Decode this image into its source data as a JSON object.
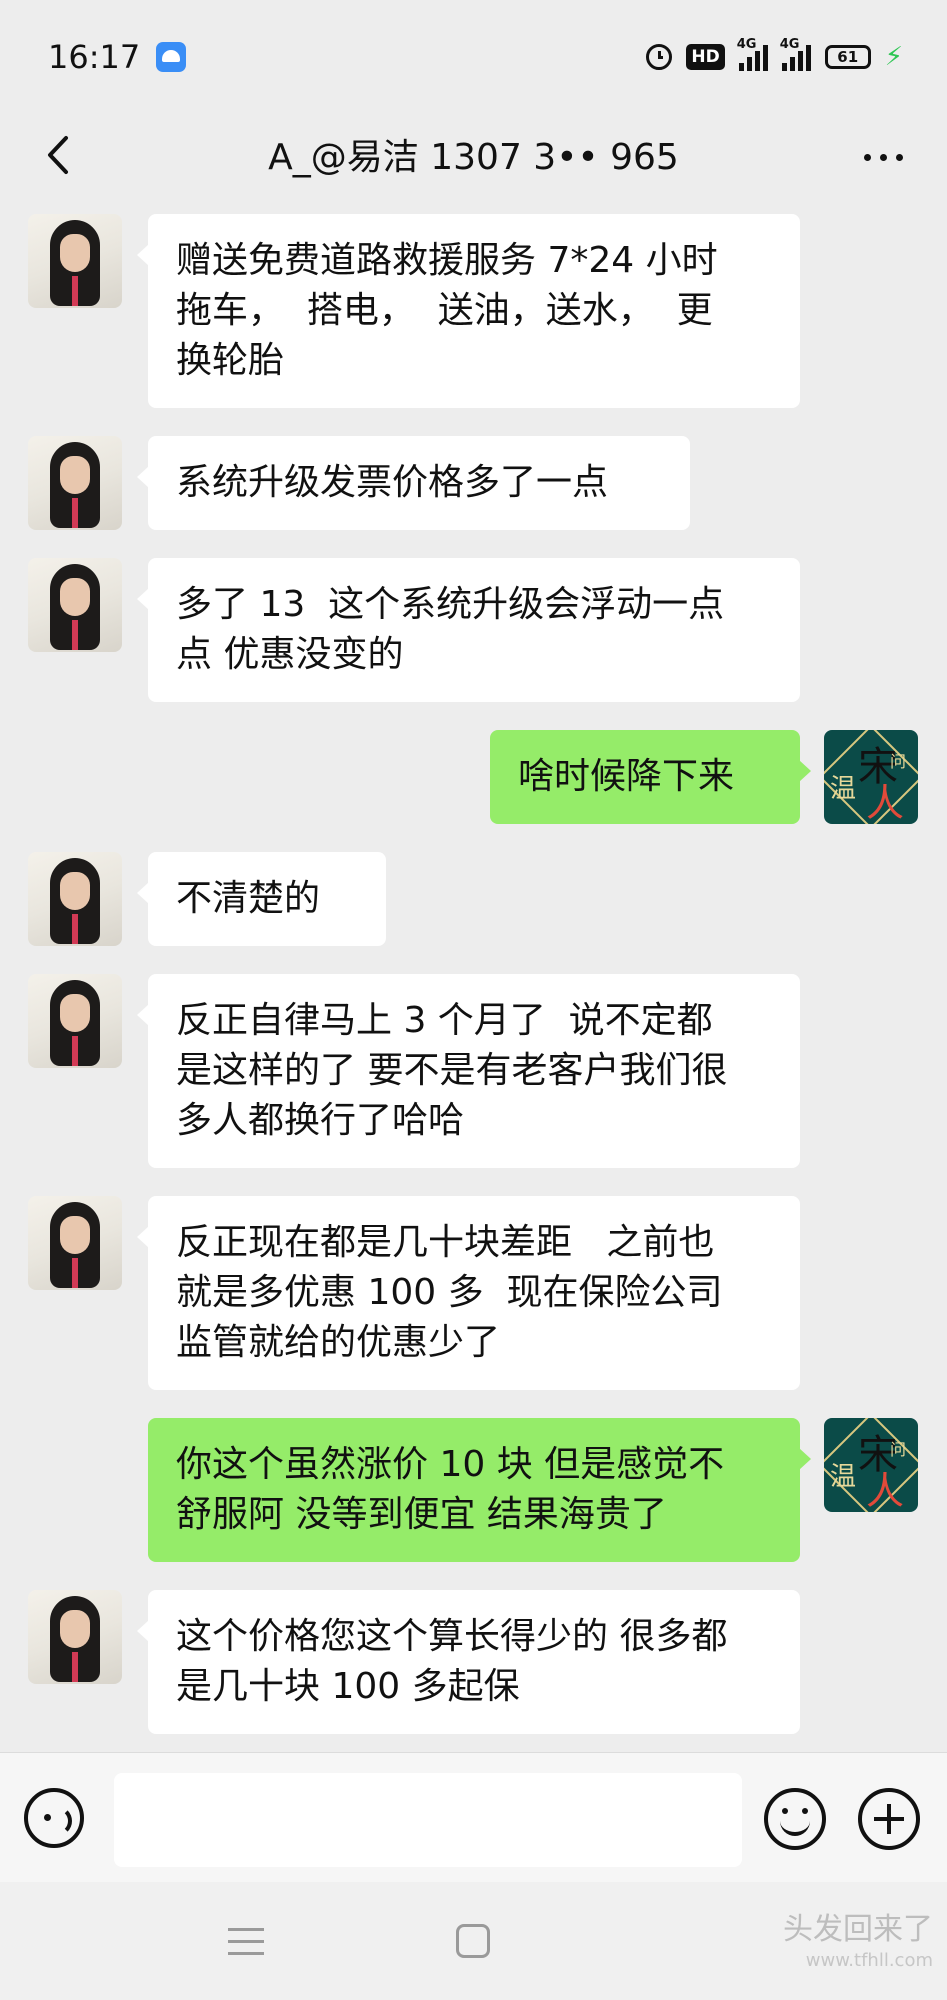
{
  "status_bar": {
    "time": "16:17",
    "network_1": "4G",
    "network_2": "4G",
    "hd_label": "HD",
    "battery": "61"
  },
  "header": {
    "title": "A_@易洁 1307 3•• 965"
  },
  "messages": [
    {
      "side": "left",
      "text": "赠送免费道路救援服务 7*24 小时\n拖车，  搭电，  送油，送水，  更\n换轮胎"
    },
    {
      "side": "left",
      "text": "系统升级发票价格多了一点"
    },
    {
      "side": "left",
      "text": "多了 13  这个系统升级会浮动一点\n点 优惠没变的"
    },
    {
      "side": "right",
      "text": "啥时候降下来"
    },
    {
      "side": "left",
      "text": "不清楚的"
    },
    {
      "side": "left",
      "text": "反正自律马上 3 个月了  说不定都\n是这样的了 要不是有老客户我们很\n多人都换行了哈哈"
    },
    {
      "side": "left",
      "text": "反正现在都是几十块差距   之前也\n就是多优惠 100 多  现在保险公司\n监管就给的优惠少了"
    },
    {
      "side": "right",
      "text": "你这个虽然涨价 10 块 但是感觉不\n舒服阿 没等到便宜 结果海贵了"
    },
    {
      "side": "left",
      "text": "这个价格您这个算长得少的 很多都\n是几十块 100 多起保"
    }
  ],
  "self_avatar": {
    "chars": [
      "宋",
      "温",
      "人",
      "问"
    ]
  },
  "watermark": {
    "text": "头发回来了",
    "url": "www.tfhll.com"
  }
}
